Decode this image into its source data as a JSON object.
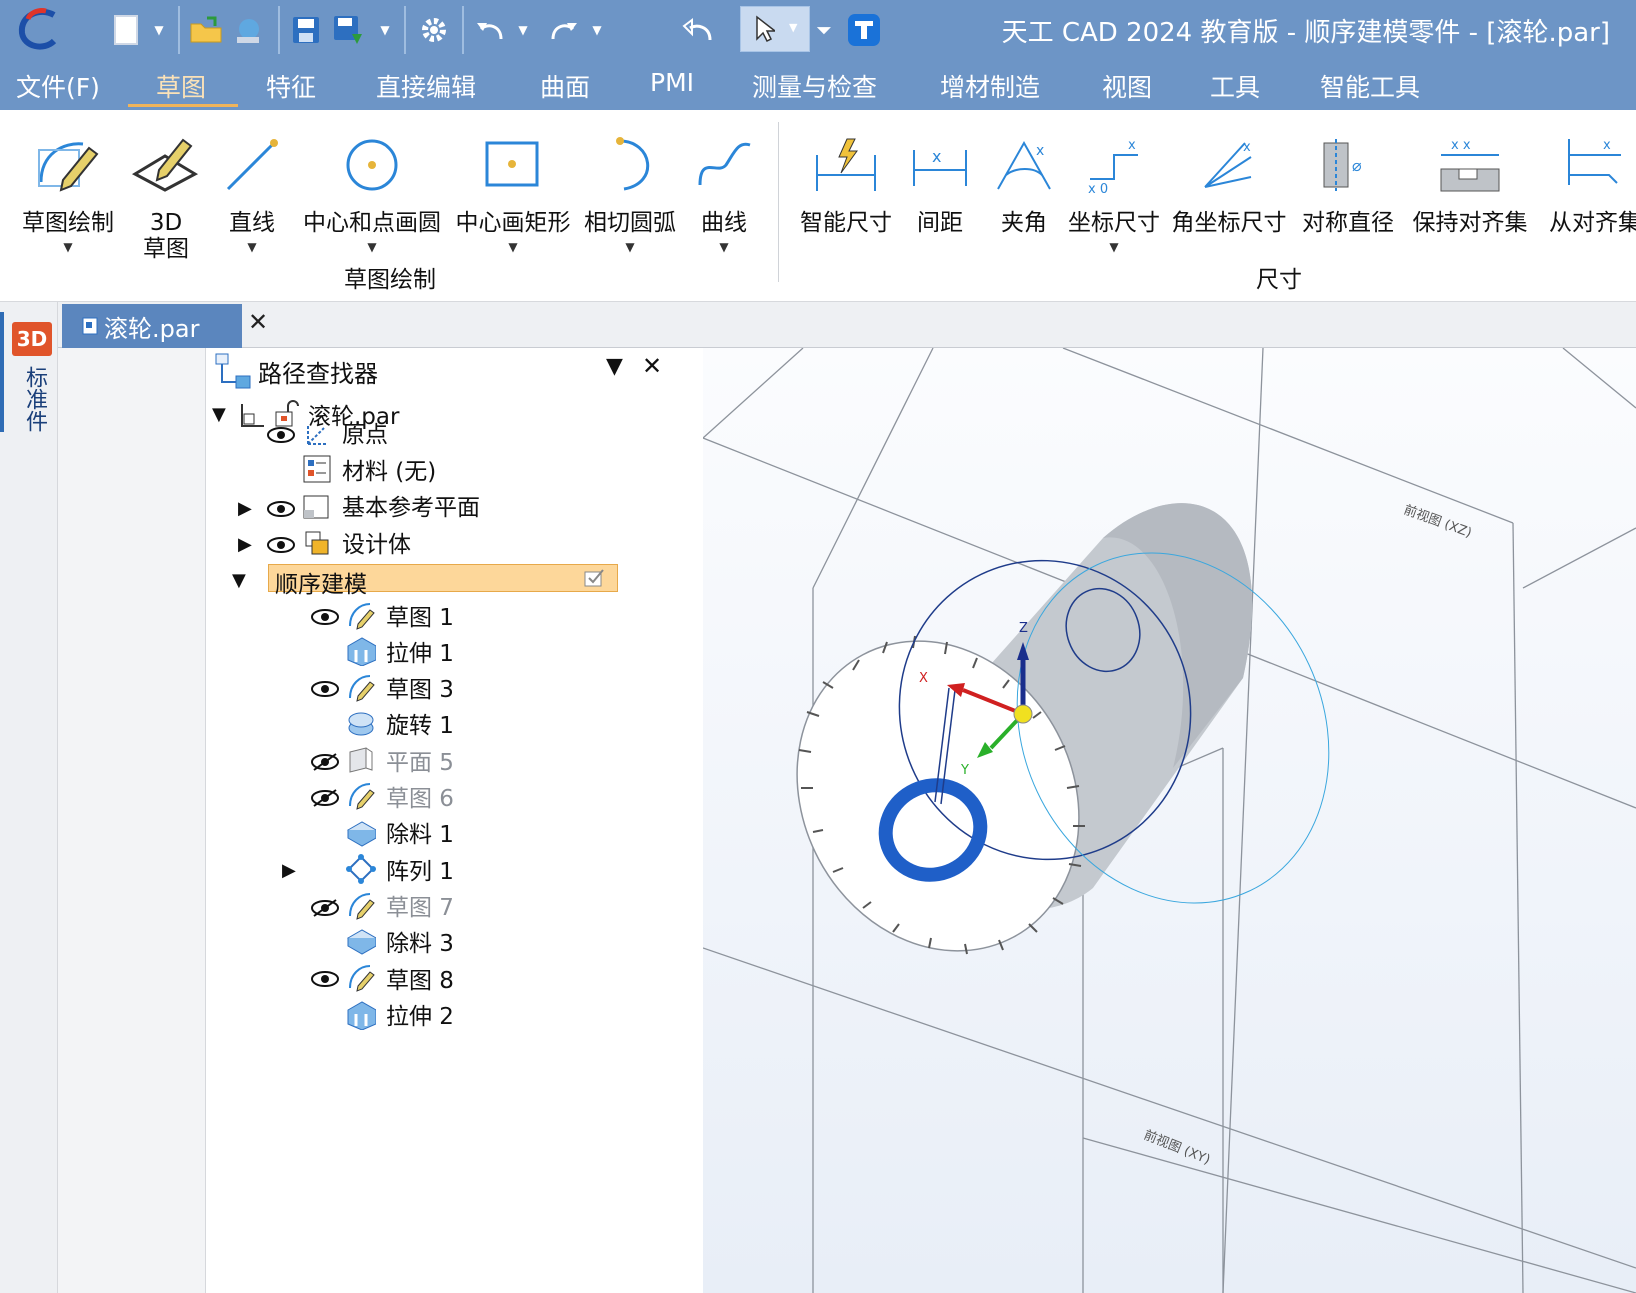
{
  "window": {
    "title": "天工 CAD 2024 教育版 - 顺序建模零件 - [滚轮.par]"
  },
  "menu": {
    "items": [
      "文件(F)",
      "草图",
      "特征",
      "直接编辑",
      "曲面",
      "PMI",
      "测量与检查",
      "增材制造",
      "视图",
      "工具",
      "智能工具"
    ],
    "active_index": 1
  },
  "ribbon": {
    "groups": {
      "sketch": "草图绘制",
      "dimension": "尺寸"
    },
    "tools": {
      "sketch_draw": "草图绘制",
      "sketch3d_line1": "3D",
      "sketch3d_line2": "草图",
      "line": "直线",
      "circle": "中心和点画圆",
      "rect": "中心画矩形",
      "arc": "相切圆弧",
      "curve": "曲线",
      "smart_dim": "智能尺寸",
      "distance": "间距",
      "angle": "夹角",
      "coord_dim": "坐标尺寸",
      "angle_coord": "角坐标尺寸",
      "sym_dia": "对称直径",
      "keep_align": "保持对齐集",
      "from_align": "从对齐集"
    }
  },
  "sidebar": {
    "badge": "3D",
    "label": "标准件"
  },
  "doc_tab": {
    "label": "滚轮.par",
    "close": "✕"
  },
  "pathfinder": {
    "title": "路径查找器",
    "root": "滚轮.par",
    "items": [
      {
        "label": "原点"
      },
      {
        "label": "材料 (无)"
      },
      {
        "label": "基本参考平面"
      },
      {
        "label": "设计体"
      },
      {
        "label": "顺序建模"
      }
    ],
    "features": [
      {
        "label": "草图 1"
      },
      {
        "label": "拉伸 1"
      },
      {
        "label": "草图 3"
      },
      {
        "label": "旋转 1"
      },
      {
        "label": "平面 5"
      },
      {
        "label": "草图 6"
      },
      {
        "label": "除料 1"
      },
      {
        "label": "阵列 1"
      },
      {
        "label": "草图 7"
      },
      {
        "label": "除料 3"
      },
      {
        "label": "草图 8"
      },
      {
        "label": "拉伸 2"
      }
    ]
  },
  "viewport": {
    "plane_top": "前视图 (XZ)",
    "plane_bottom": "前视图 (XY)",
    "axis_x": "X",
    "axis_y": "Y",
    "axis_z": "Z"
  },
  "colors": {
    "titlebar": "#6d95c6",
    "menu_active": "#fbe2b8",
    "highlight": "#fdd79a",
    "accent_blue": "#1f5fc8"
  }
}
